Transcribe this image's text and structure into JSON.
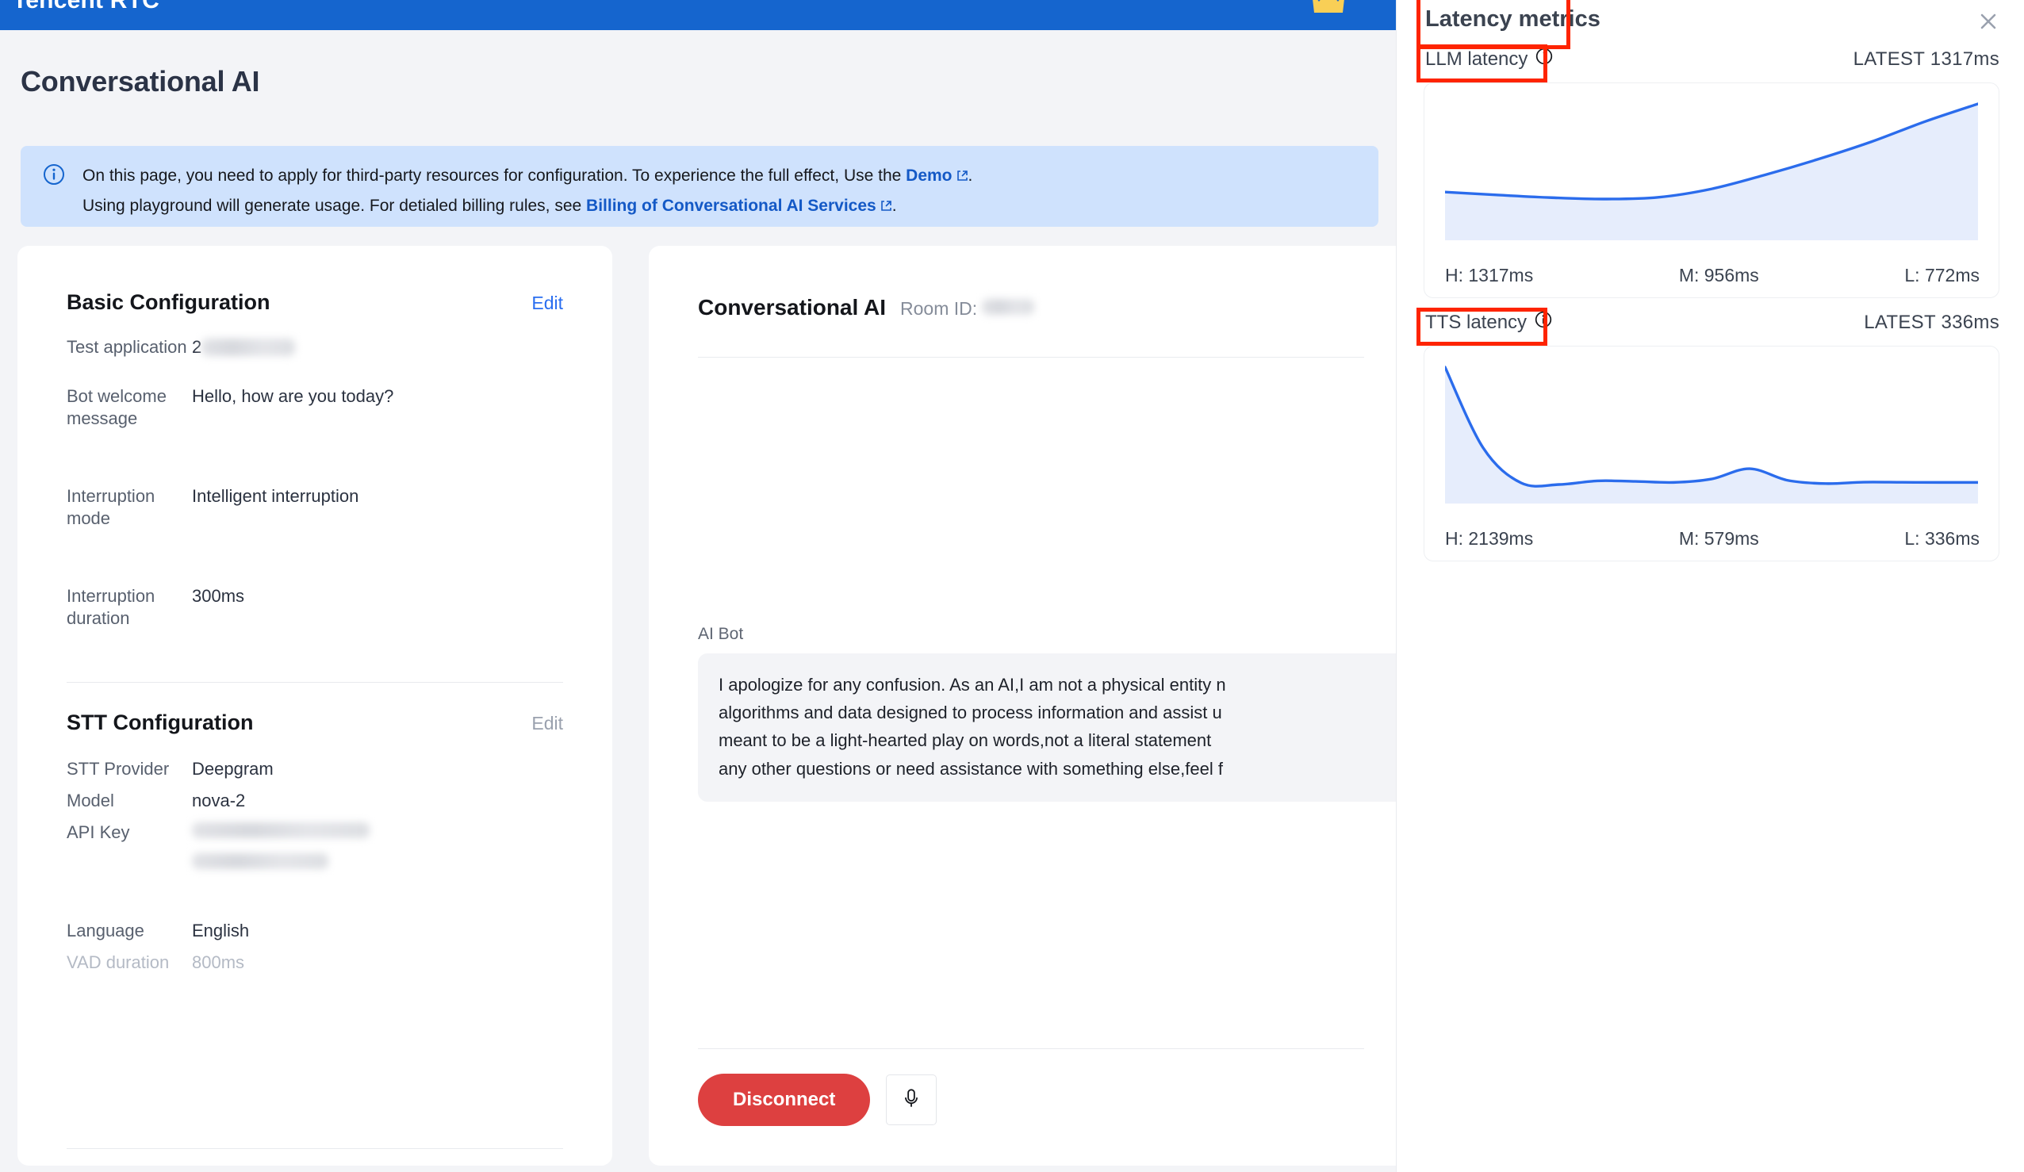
{
  "topbar": {
    "brand": "Tencent RTC",
    "crown_icon": "crown-icon"
  },
  "page": {
    "title": "Conversational AI"
  },
  "notice": {
    "icon": "info-circle-icon",
    "line1_before": "On this page, you need to apply for third-party resources for configuration. To experience the full effect, Use the ",
    "line1_link": "Demo",
    "line1_after": ".",
    "line2_before": "Using playground will generate usage. For detialed billing rules, see ",
    "line2_link": "Billing of Conversational AI Services",
    "line2_after": "."
  },
  "basic_config": {
    "title": "Basic Configuration",
    "edit_label": "Edit",
    "rows": [
      {
        "key": "Test application",
        "value": "2",
        "redacted": true
      },
      {
        "key": "Bot welcome message",
        "value": "Hello, how are you today?",
        "redacted": false
      },
      {
        "key": "Interruption mode",
        "value": "Intelligent interruption",
        "redacted": false
      },
      {
        "key": "Interruption duration",
        "value": "300ms",
        "redacted": false
      }
    ]
  },
  "stt_config": {
    "title": "STT Configuration",
    "edit_label": "Edit",
    "rows": [
      {
        "key": "STT Provider",
        "value": "Deepgram",
        "redacted": false
      },
      {
        "key": "Model",
        "value": "nova-2",
        "redacted": false
      },
      {
        "key": "API Key",
        "value": "",
        "redacted": true
      },
      {
        "key": "Language",
        "value": "English",
        "redacted": false
      },
      {
        "key": "VAD duration",
        "value": "800ms",
        "redacted": false,
        "dim": true
      }
    ]
  },
  "conversation": {
    "title": "Conversational AI",
    "room_id_label": "Room ID:",
    "room_id_value": "",
    "speaker": "AI Bot",
    "message": "I apologize for any confusion. As an AI,I am not a physical entity n\nalgorithms and data designed to process information and assist u\nmeant to be a light-hearted play on words,not a literal statement\nany other questions or need assistance with something else,feel f",
    "disconnect_label": "Disconnect",
    "mic_icon": "microphone-icon"
  },
  "metrics_panel": {
    "title": "Latency metrics",
    "close_icon": "close-icon",
    "info_icon": "info-circle-icon"
  },
  "chart_data": [
    {
      "type": "area",
      "title": "LLM latency",
      "latest_label": "LATEST 1317ms",
      "latest_value": 1317,
      "unit": "ms",
      "stats": {
        "high_label": "H: 1317ms",
        "mid_label": "M: 956ms",
        "low_label": "L: 772ms",
        "high": 1317,
        "mid": 956,
        "low": 772
      },
      "grid": false,
      "legend": "none",
      "ylim": [
        0,
        1500
      ],
      "x": [
        0,
        1,
        2,
        3,
        4,
        5,
        6,
        7,
        8,
        9,
        10
      ],
      "values": [
        812,
        795,
        780,
        772,
        782,
        830,
        910,
        1000,
        1100,
        1215,
        1317
      ],
      "xlabel": "",
      "ylabel": "",
      "line_color": "#2b6cec",
      "fill_color": "#e6edfc"
    },
    {
      "type": "area",
      "title": "TTS latency",
      "latest_label": "LATEST 336ms",
      "latest_value": 336,
      "unit": "ms",
      "stats": {
        "high_label": "H: 2139ms",
        "mid_label": "M: 579ms",
        "low_label": "L: 336ms",
        "high": 2139,
        "mid": 579,
        "low": 336
      },
      "grid": false,
      "legend": "none",
      "ylim": [
        0,
        2300
      ],
      "x": [
        0,
        1,
        2,
        3,
        4,
        5,
        6,
        7,
        8,
        9,
        10,
        11,
        12,
        13,
        14
      ],
      "values": [
        2139,
        900,
        360,
        336,
        392,
        384,
        368,
        420,
        579,
        400,
        350,
        372,
        370,
        368,
        368
      ],
      "xlabel": "",
      "ylabel": "",
      "line_color": "#2b6cec",
      "fill_color": "#e6edfc"
    }
  ],
  "colors": {
    "header_blue": "#1565ce",
    "accent_blue": "#2a6ef0",
    "link_blue": "#1459c6",
    "notice_bg": "#cfe2fd",
    "danger_red": "#dd4040",
    "annotation_red": "#fe2400",
    "chart_line": "#2b6cec",
    "chart_fill": "#e6edfc",
    "page_bg": "#f3f4f7",
    "crown_yellow": "#f9cf56"
  }
}
